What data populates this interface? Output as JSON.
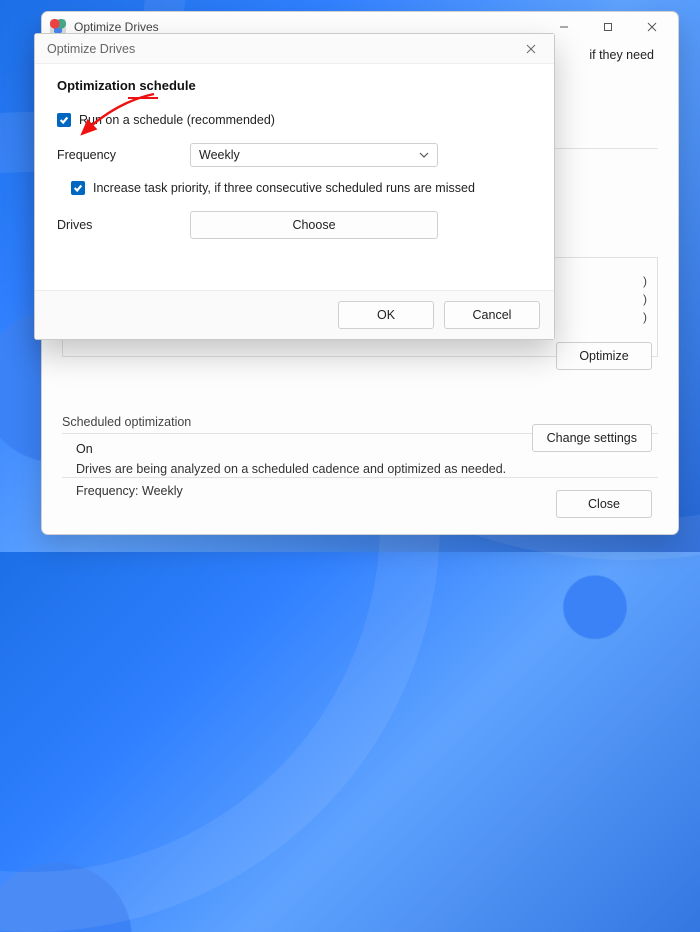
{
  "main_window": {
    "title": "Optimize Drives",
    "partial_text": "if they need",
    "status_parens": [
      ")",
      ")",
      ")"
    ],
    "optimize_label": "Optimize",
    "section_label": "Scheduled optimization",
    "sched_status": "On",
    "sched_desc": "Drives are being analyzed on a scheduled cadence and optimized as needed.",
    "sched_freq": "Frequency: Weekly",
    "change_settings_label": "Change settings",
    "close_label": "Close"
  },
  "dialog": {
    "title": "Optimize Drives",
    "heading": "Optimization schedule",
    "run_schedule": {
      "checked": true,
      "label": "Run on a schedule (recommended)"
    },
    "frequency_label": "Frequency",
    "frequency_value": "Weekly",
    "priority": {
      "checked": true,
      "label": "Increase task priority, if three consecutive scheduled runs are missed"
    },
    "drives_label": "Drives",
    "choose_label": "Choose",
    "ok_label": "OK",
    "cancel_label": "Cancel"
  },
  "colors": {
    "accent": "#0067c0"
  }
}
